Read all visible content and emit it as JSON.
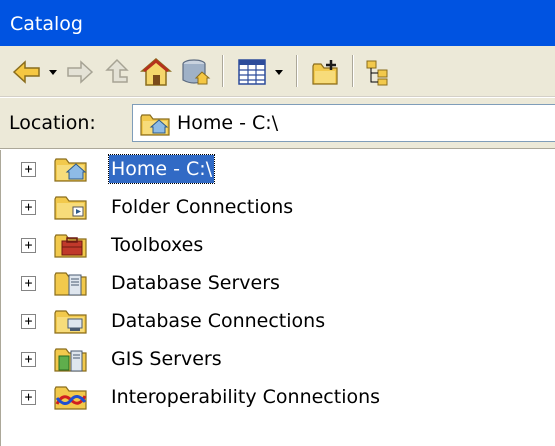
{
  "window": {
    "title": "Catalog"
  },
  "toolbar": {
    "buttons": [
      {
        "name": "back-button",
        "icon": "back-arrow-icon"
      },
      {
        "name": "back-dropdown-button",
        "icon": "dropdown-arrow-icon"
      },
      {
        "name": "forward-button",
        "icon": "forward-arrow-icon"
      },
      {
        "name": "up-level-button",
        "icon": "up-level-icon"
      },
      {
        "name": "home-button",
        "icon": "home-icon"
      },
      {
        "name": "default-geodatabase-button",
        "icon": "geodatabase-home-icon"
      },
      {
        "name": "view-button",
        "icon": "table-view-icon"
      },
      {
        "name": "view-dropdown-button",
        "icon": "dropdown-arrow-icon"
      },
      {
        "name": "connect-folder-button",
        "icon": "connect-folder-icon"
      },
      {
        "name": "toggle-contents-button",
        "icon": "tree-toggle-icon"
      }
    ]
  },
  "location": {
    "label": "Location:",
    "value": "Home - C:\\",
    "icon": "home-folder-icon"
  },
  "tree": {
    "items": [
      {
        "label": "Home - C:\\",
        "icon": "home-folder-icon",
        "selected": true
      },
      {
        "label": "Folder Connections",
        "icon": "folder-connections-icon",
        "selected": false
      },
      {
        "label": "Toolboxes",
        "icon": "toolbox-icon",
        "selected": false
      },
      {
        "label": "Database Servers",
        "icon": "database-servers-icon",
        "selected": false
      },
      {
        "label": "Database Connections",
        "icon": "database-connections-icon",
        "selected": false
      },
      {
        "label": "GIS Servers",
        "icon": "gis-servers-icon",
        "selected": false
      },
      {
        "label": "Interoperability Connections",
        "icon": "interoperability-icon",
        "selected": false
      }
    ],
    "expander_symbol": "+"
  },
  "colors": {
    "title_bar": "#0053e1",
    "toolbar_bg": "#ece9d8",
    "selection": "#316ac5",
    "folder_yellow": "#f2c94c"
  }
}
